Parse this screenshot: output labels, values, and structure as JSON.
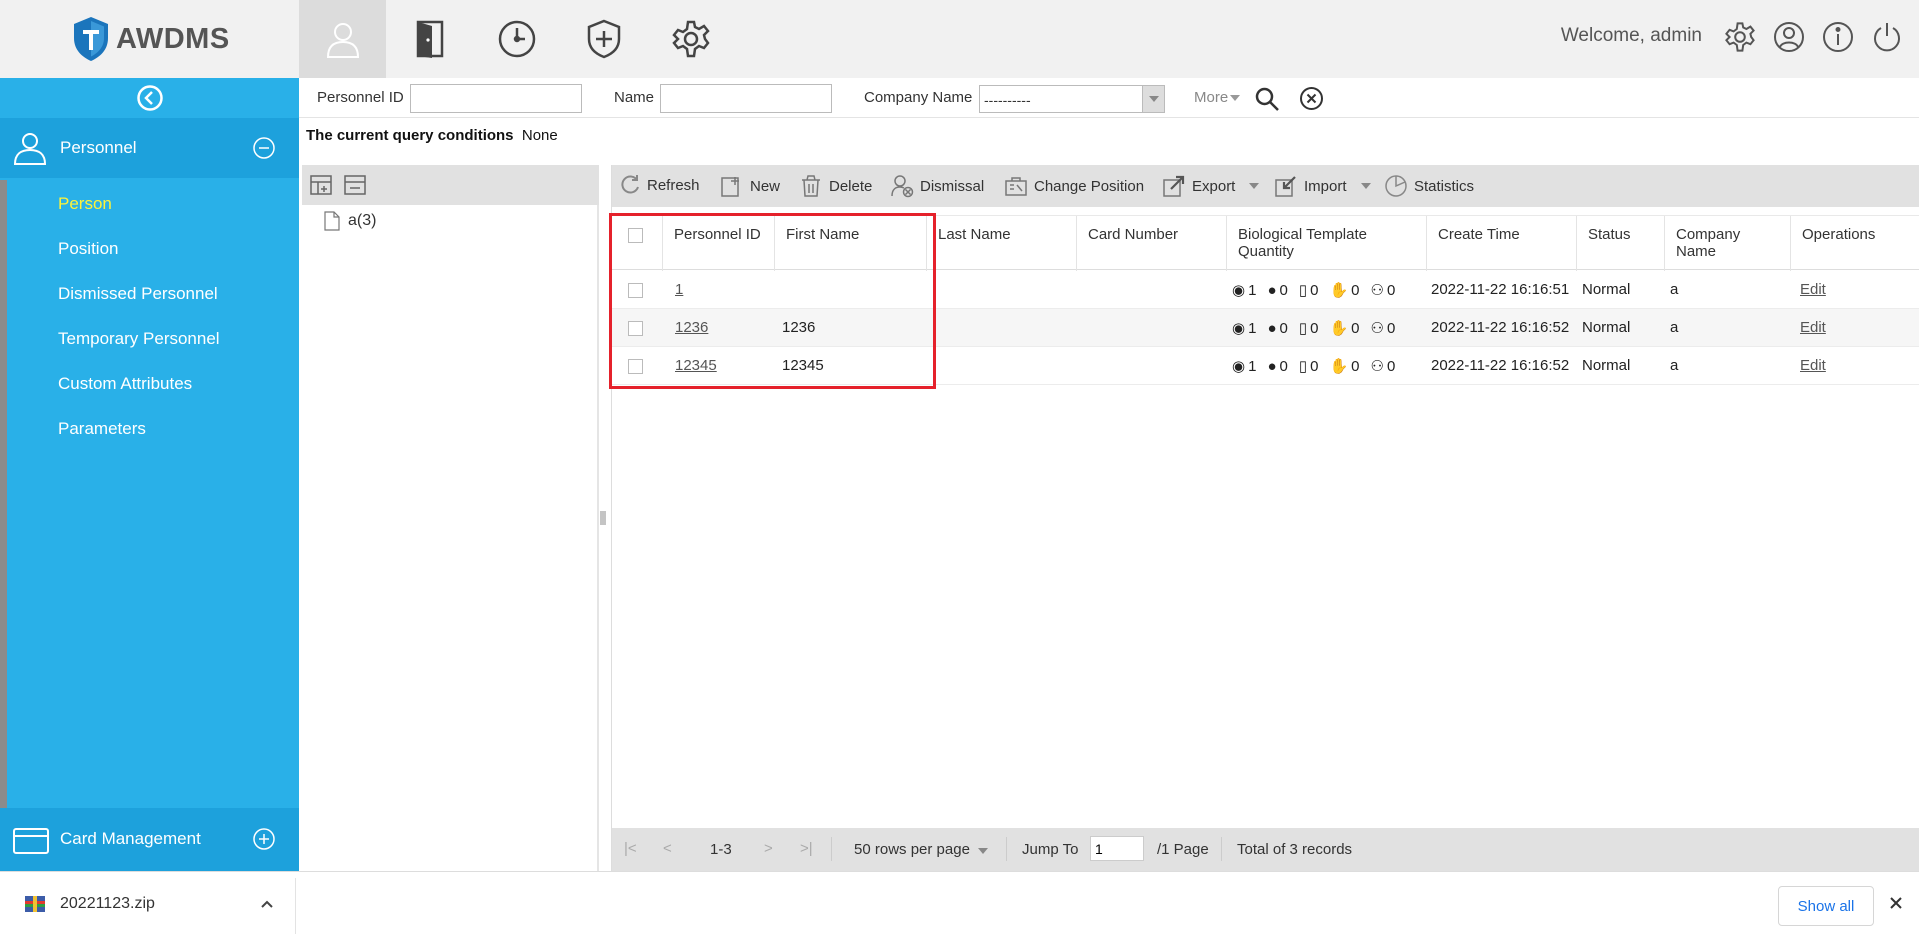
{
  "app": {
    "logo_text": "AWDMS"
  },
  "header": {
    "welcome": "Welcome, admin",
    "nav_icons": [
      "person-icon",
      "door-icon",
      "clock-icon",
      "shield-plus-icon",
      "gear-icon"
    ],
    "right_icons": [
      "settings-icon",
      "user-circle-icon",
      "info-icon",
      "power-icon"
    ]
  },
  "sidebar": {
    "section": "Personnel",
    "items": [
      {
        "label": "Person",
        "active": true
      },
      {
        "label": "Position"
      },
      {
        "label": "Dismissed Personnel"
      },
      {
        "label": "Temporary Personnel"
      },
      {
        "label": "Custom Attributes"
      },
      {
        "label": "Parameters"
      }
    ],
    "bottom_section": "Card Management"
  },
  "filter": {
    "personnel_id_label": "Personnel ID",
    "name_label": "Name",
    "company_label": "Company Name",
    "company_value": "----------",
    "more_label": "More"
  },
  "query": {
    "label": "The current query conditions",
    "value": "None"
  },
  "tree": {
    "node": "a(3)"
  },
  "toolbar": {
    "refresh": "Refresh",
    "new": "New",
    "delete": "Delete",
    "dismissal": "Dismissal",
    "change_position": "Change Position",
    "export": "Export",
    "import": "Import",
    "statistics": "Statistics"
  },
  "table": {
    "columns": {
      "personnel_id": "Personnel ID",
      "first_name": "First Name",
      "last_name": "Last Name",
      "card_number": "Card Number",
      "bio_1": "Biological Template",
      "bio_2": "Quantity",
      "create_time": "Create Time",
      "status": "Status",
      "company_name": "Company Name",
      "operations": "Operations"
    },
    "rows": [
      {
        "id": "1",
        "first_name": "",
        "last_name": "",
        "card": "",
        "bio": [
          "1",
          "0",
          "0",
          "0",
          "0"
        ],
        "create_time": "2022-11-22 16:16:51",
        "status": "Normal",
        "company": "a",
        "op": "Edit"
      },
      {
        "id": "1236",
        "first_name": "1236",
        "last_name": "",
        "card": "",
        "bio": [
          "1",
          "0",
          "0",
          "0",
          "0"
        ],
        "create_time": "2022-11-22 16:16:52",
        "status": "Normal",
        "company": "a",
        "op": "Edit"
      },
      {
        "id": "12345",
        "first_name": "12345",
        "last_name": "",
        "card": "",
        "bio": [
          "1",
          "0",
          "0",
          "0",
          "0"
        ],
        "create_time": "2022-11-22 16:16:52",
        "status": "Normal",
        "company": "a",
        "op": "Edit"
      }
    ]
  },
  "pager": {
    "range": "1-3",
    "rows_per_page": "50 rows per page",
    "jump_to": "Jump To",
    "page_value": "1",
    "page_total": "/1 Page",
    "total": "Total of 3 records"
  },
  "downloads": {
    "file": "20221123.zip",
    "show_all": "Show all"
  },
  "colors": {
    "sidebar": "#29b0e8",
    "active_item": "#fdf33a",
    "highlight": "#e5212b"
  }
}
